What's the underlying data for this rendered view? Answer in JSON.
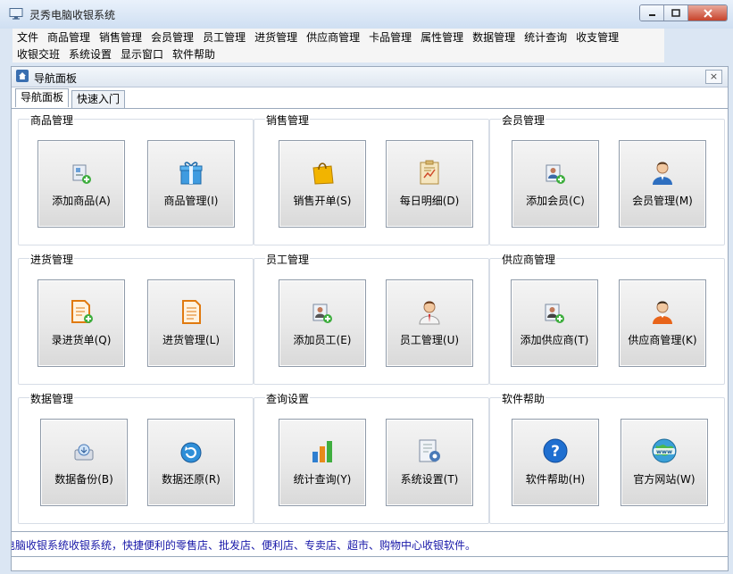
{
  "window": {
    "title": "灵秀电脑收银系统",
    "minimize": "0",
    "maximize": "1",
    "close": "X"
  },
  "menubar": {
    "row1": [
      "文件",
      "商品管理",
      "销售管理",
      "会员管理",
      "员工管理",
      "进货管理",
      "供应商管理",
      "卡品管理",
      "属性管理",
      "数据管理",
      "统计查询",
      "收支管理"
    ],
    "row2": [
      "收银交班",
      "系统设置",
      "显示窗口",
      "软件帮助"
    ]
  },
  "panel": {
    "title": "导航面板",
    "close": "×"
  },
  "tabs": [
    {
      "label": "导航面板"
    },
    {
      "label": "快速入门"
    }
  ],
  "groups": [
    {
      "title": "商品管理",
      "buttons": [
        {
          "label": "添加商品(A)",
          "icon": "add-product-icon"
        },
        {
          "label": "商品管理(I)",
          "icon": "gift-box-icon"
        }
      ]
    },
    {
      "title": "销售管理",
      "buttons": [
        {
          "label": "销售开单(S)",
          "icon": "shopping-bag-icon"
        },
        {
          "label": "每日明细(D)",
          "icon": "clipboard-chart-icon"
        }
      ]
    },
    {
      "title": "会员管理",
      "buttons": [
        {
          "label": "添加会员(C)",
          "icon": "add-member-icon"
        },
        {
          "label": "会员管理(M)",
          "icon": "member-person-icon"
        }
      ]
    },
    {
      "title": "进货管理",
      "buttons": [
        {
          "label": "录进货单(Q)",
          "icon": "add-document-icon"
        },
        {
          "label": "进货管理(L)",
          "icon": "document-list-icon"
        }
      ]
    },
    {
      "title": "员工管理",
      "buttons": [
        {
          "label": "添加员工(E)",
          "icon": "add-employee-icon"
        },
        {
          "label": "员工管理(U)",
          "icon": "employee-person-icon"
        }
      ]
    },
    {
      "title": "供应商管理",
      "buttons": [
        {
          "label": "添加供应商(T)",
          "icon": "add-supplier-icon"
        },
        {
          "label": "供应商管理(K)",
          "icon": "supplier-person-icon"
        }
      ]
    },
    {
      "title": "数据管理",
      "buttons": [
        {
          "label": "数据备份(B)",
          "icon": "backup-disk-icon"
        },
        {
          "label": "数据还原(R)",
          "icon": "restore-icon"
        }
      ]
    },
    {
      "title": "查询设置",
      "buttons": [
        {
          "label": "统计查询(Y)",
          "icon": "bar-chart-icon"
        },
        {
          "label": "系统设置(T)",
          "icon": "settings-doc-icon"
        }
      ]
    },
    {
      "title": "软件帮助",
      "buttons": [
        {
          "label": "软件帮助(H)",
          "icon": "help-icon"
        },
        {
          "label": "官方网站(W)",
          "icon": "globe-www-icon"
        }
      ]
    }
  ],
  "status": {
    "text": "电脑收银系统收银系统，快捷便利的零售店、批发店、便利店、专卖店、超市、购物中心收银软件。"
  }
}
